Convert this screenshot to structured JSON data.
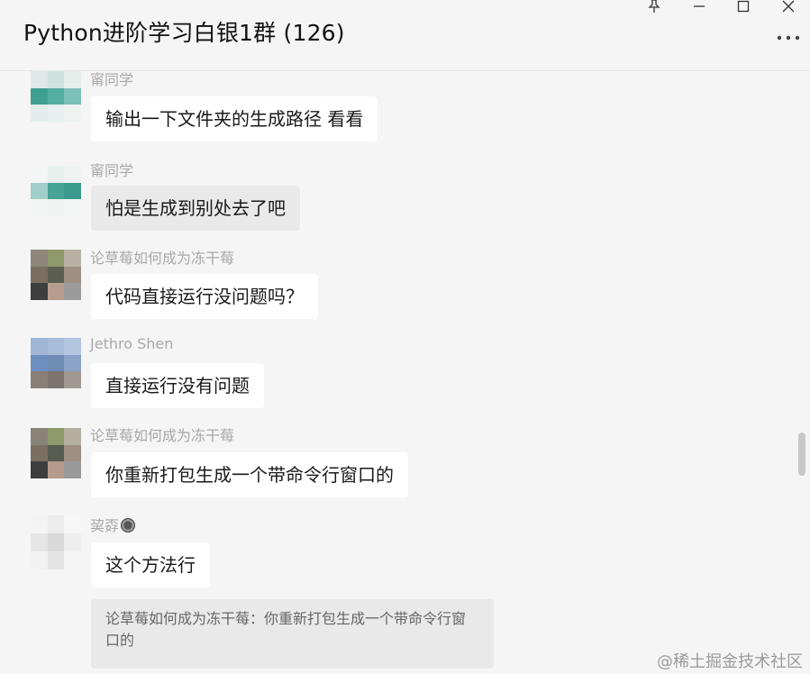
{
  "window": {
    "title": "Python进阶学习白银1群 (126)",
    "pin_icon": "pin-icon",
    "minimize_icon": "minimize-icon",
    "maximize_icon": "maximize-icon",
    "close_icon": "close-icon",
    "more_icon": "more-horizontal-icon"
  },
  "messages": [
    {
      "sender": "甯同学",
      "text": "输出一下文件夹的生成路径 看看"
    },
    {
      "sender": "甯同学",
      "text": "怕是生成到别处去了吧"
    },
    {
      "sender": "论草莓如何成为冻干莓",
      "text": "代码直接运行没问题吗？"
    },
    {
      "sender": "Jethro Shen",
      "text": "直接运行没有问题"
    },
    {
      "sender": "论草莓如何成为冻干莓",
      "text": "你重新打包生成一个带命令行窗口的"
    },
    {
      "sender": "巭孬",
      "text": "这个方法行"
    }
  ],
  "quote": {
    "text": "论草莓如何成为冻干莓：你重新打包生成一个带命令行窗口的"
  },
  "watermark": "@稀土掘金技术社区",
  "colors": {
    "background": "#f5f5f5",
    "bubble": "#ffffff",
    "bubble_highlight": "#e9e9e9",
    "sender_name": "#a8a8a8"
  }
}
